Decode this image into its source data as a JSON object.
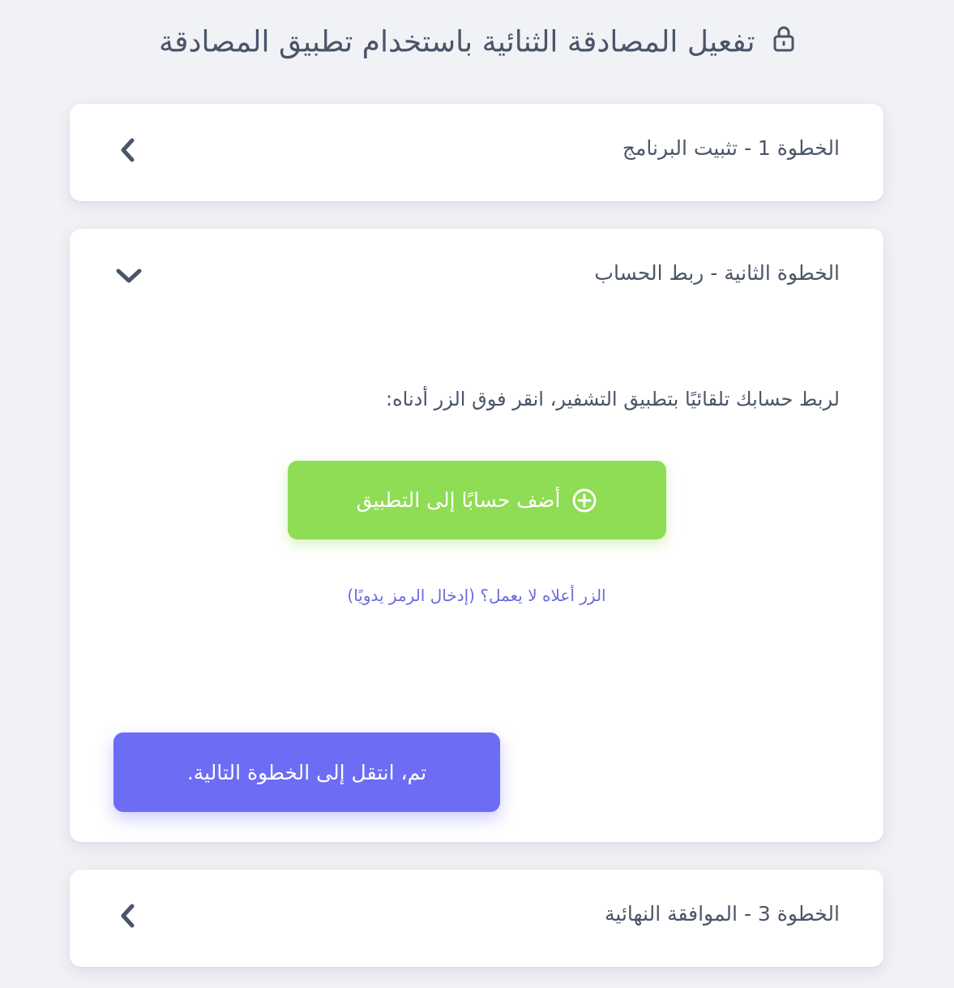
{
  "header": {
    "title": "تفعيل المصادقة الثنائية باستخدام تطبيق المصادقة",
    "icon": "lock-icon"
  },
  "steps": [
    {
      "title": "الخطوة 1 - تثبيت البرنامج",
      "expanded": false,
      "chevron": "chevron-left-icon"
    },
    {
      "title": "الخطوة الثانية - ربط الحساب",
      "expanded": true,
      "chevron": "chevron-down-icon",
      "instruction": "لربط حسابك تلقائيًا بتطبيق التشفير، انقر فوق الزر أدناه:",
      "add_button_label": "أضف حسابًا إلى التطبيق",
      "add_button_icon": "plus-circle-icon",
      "manual_link": "الزر أعلاه لا يعمل؟ (إدخال الرمز يدويًا)",
      "next_button_label": "تم، انتقل إلى الخطوة التالية."
    },
    {
      "title": "الخطوة 3 - الموافقة النهائية",
      "expanded": false,
      "chevron": "chevron-left-icon"
    }
  ],
  "colors": {
    "background": "#f1f2f6",
    "card": "#ffffff",
    "text": "#4a5568",
    "add_button": "#8fdc55",
    "next_button": "#6c6cf5",
    "link": "#6b6bdc"
  }
}
